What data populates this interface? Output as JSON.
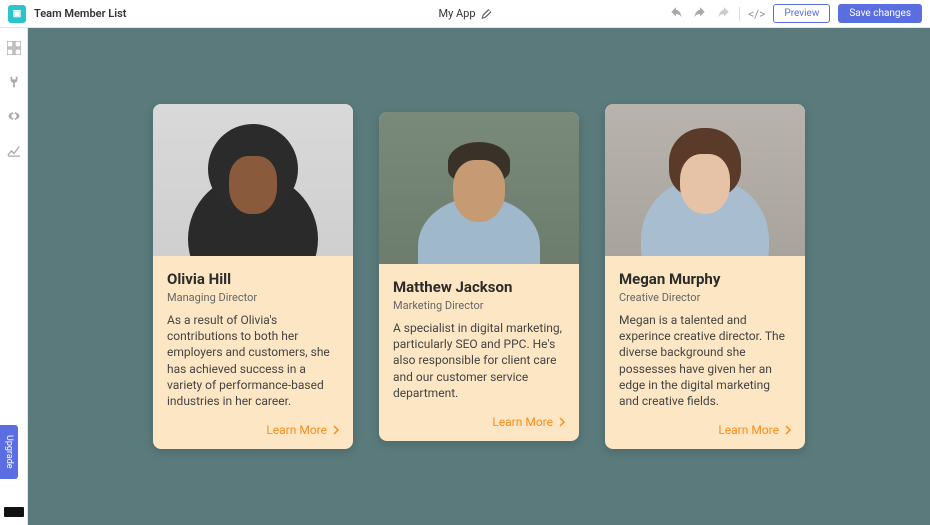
{
  "topbar": {
    "page_title": "Team Member List",
    "app_name": "My App",
    "preview_label": "Preview",
    "save_label": "Save changes"
  },
  "upgrade_label": "Upgrade",
  "link_label": "Learn More",
  "cards": [
    {
      "name": "Olivia Hill",
      "role": "Managing Director",
      "bio": "As a result of Olivia's contributions to both her employers and customers, she has achieved success in a variety of performance-based industries in her career."
    },
    {
      "name": "Matthew Jackson",
      "role": "Marketing Director",
      "bio": "A specialist in digital marketing, particularly SEO and PPC. He's also responsible for client care and our customer service department."
    },
    {
      "name": "Megan Murphy",
      "role": "Creative Director",
      "bio": "Megan is a talented and experince creative director. The diverse background she possesses have given her an edge in the digital marketing and creative fields."
    }
  ]
}
